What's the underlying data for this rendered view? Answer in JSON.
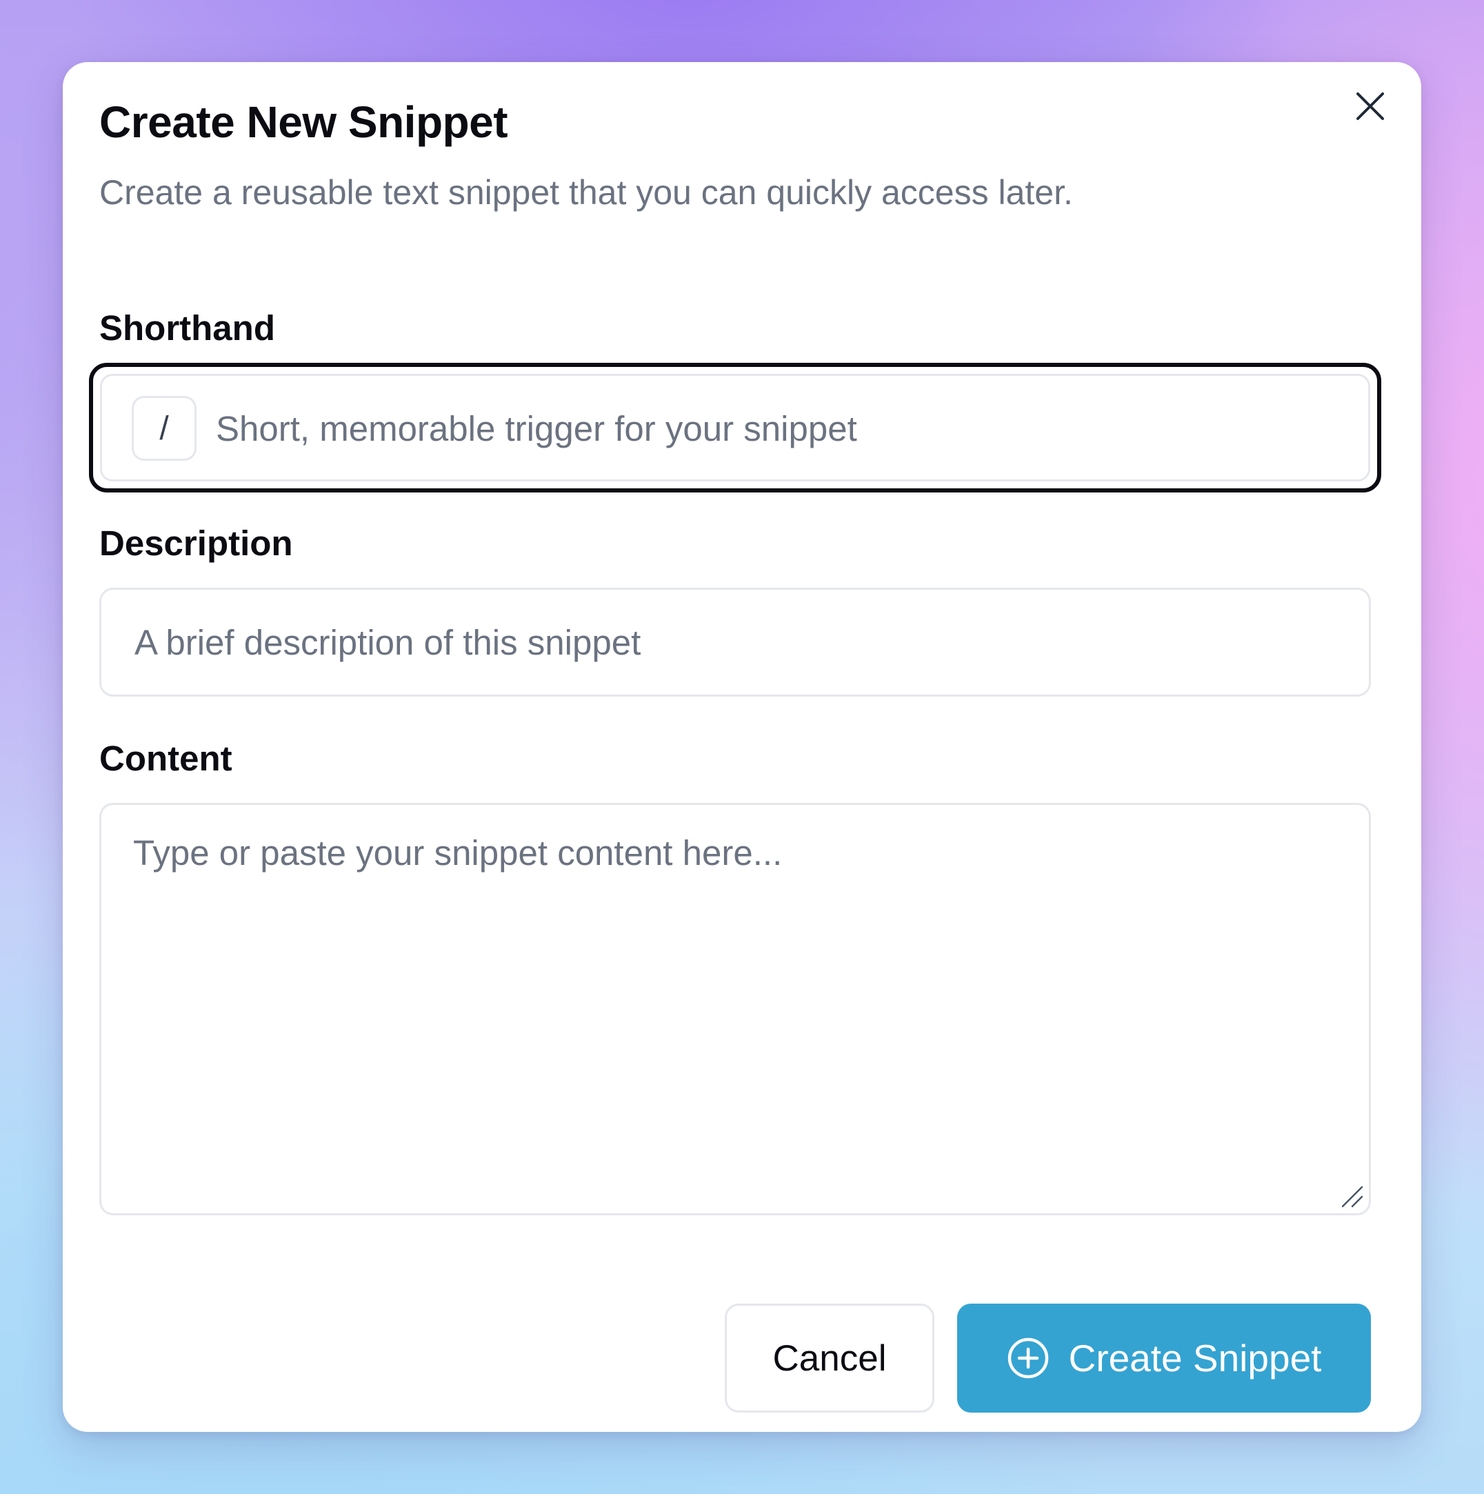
{
  "dialog": {
    "title": "Create New Snippet",
    "subtitle": "Create a reusable text snippet that you can quickly access later.",
    "close_icon": "close-icon"
  },
  "fields": {
    "shorthand": {
      "label": "Shorthand",
      "prefix": "/",
      "value": "",
      "placeholder": "Short, memorable trigger for your snippet",
      "focused": true
    },
    "description": {
      "label": "Description",
      "value": "",
      "placeholder": "A brief description of this snippet"
    },
    "content": {
      "label": "Content",
      "value": "",
      "placeholder": "Type or paste your snippet content here..."
    }
  },
  "actions": {
    "cancel_label": "Cancel",
    "create_label": "Create Snippet",
    "create_icon": "plus-circle-icon"
  },
  "colors": {
    "primary": "#34a3d2",
    "focus_ring": "#0b0b12",
    "border": "#e5e7eb",
    "muted_text": "#6b7280"
  }
}
